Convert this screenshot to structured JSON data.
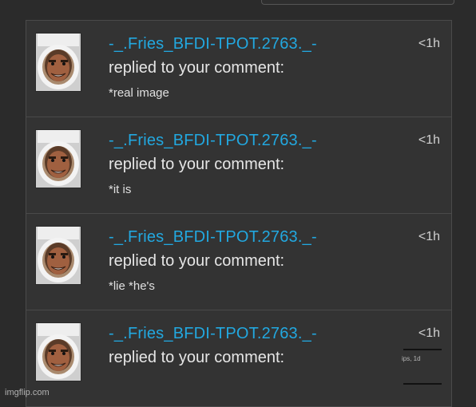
{
  "notifications": [
    {
      "username": "-_.Fries_BFDI-TPOT.2763._-",
      "action": "replied to your comment:",
      "comment": "*real image",
      "time": "<1h"
    },
    {
      "username": "-_.Fries_BFDI-TPOT.2763._-",
      "action": "replied to your comment:",
      "comment": "*it is",
      "time": "<1h"
    },
    {
      "username": "-_.Fries_BFDI-TPOT.2763._-",
      "action": "replied to your comment:",
      "comment": "*lie *he's",
      "time": "<1h"
    },
    {
      "username": "-_.Fries_BFDI-TPOT.2763._-",
      "action": "replied to your comment:",
      "comment": "",
      "time": "<1h"
    }
  ],
  "overlay_fragment": "ips, 1d",
  "watermark": "imgflip.com",
  "colors": {
    "background": "#2b2b2b",
    "panel": "#333333",
    "username": "#22a8e0",
    "text": "#e6e6e6"
  }
}
